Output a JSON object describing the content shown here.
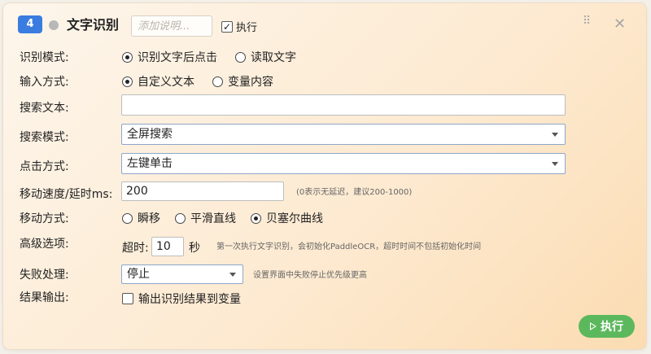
{
  "header": {
    "step_number": "4",
    "title": "文字识别",
    "description_placeholder": "添加说明...",
    "description_value": "",
    "execute_label": "执行",
    "execute_checked": true,
    "close_glyph": "✕",
    "drag_glyph": "⠿"
  },
  "recognition_mode": {
    "label": "识别模式:",
    "options": [
      "识别文字后点击",
      "读取文字"
    ],
    "selected": 0
  },
  "input_mode": {
    "label": "输入方式:",
    "options": [
      "自定义文本",
      "变量内容"
    ],
    "selected": 0
  },
  "search_text": {
    "label": "搜索文本:",
    "value": ""
  },
  "search_mode": {
    "label": "搜索模式:",
    "value": "全屏搜索"
  },
  "click_mode": {
    "label": "点击方式:",
    "value": "左键单击"
  },
  "move_speed": {
    "label": "移动速度/延时ms:",
    "value": "200",
    "hint": "(0表示无延迟，建议200-1000)"
  },
  "move_mode": {
    "label": "移动方式:",
    "options": [
      "瞬移",
      "平滑直线",
      "贝塞尔曲线"
    ],
    "selected": 2
  },
  "advanced": {
    "label": "高级选项:",
    "timeout_label": "超时:",
    "timeout_value": "10",
    "timeout_unit": "秒",
    "hint": "第一次执行文字识别，会初始化PaddleOCR，超时时间不包括初始化时间"
  },
  "failure": {
    "label": "失败处理:",
    "value": "停止",
    "hint": "设置界面中失败停止优先级更高"
  },
  "result_output": {
    "label": "结果输出:",
    "checkbox_label": "输出识别结果到变量",
    "checked": false
  },
  "run_button": {
    "label": "执行"
  },
  "colors": {
    "accent": "#3a7ce0",
    "run_button": "#5cb85c",
    "card_gradient_start": "#fdf6ec",
    "card_gradient_end": "#fbdcb2"
  }
}
